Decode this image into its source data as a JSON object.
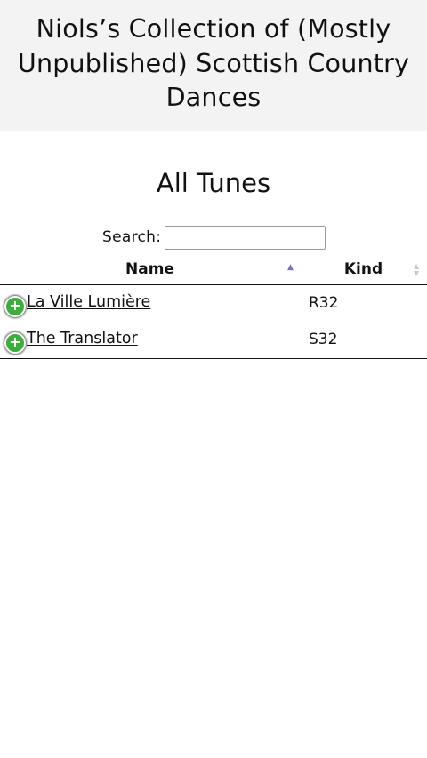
{
  "header": {
    "site_title": "Niols’s Collection of (Mostly Unpublished) Scottish Country Dances"
  },
  "page": {
    "title": "All Tunes"
  },
  "search": {
    "label": "Search:",
    "value": "",
    "placeholder": ""
  },
  "table": {
    "columns": [
      {
        "label": "Name",
        "sort": "ascending",
        "sort_icon": "sort-ascending-icon"
      },
      {
        "label": "Kind",
        "sort": "none",
        "sort_icon": "sort-both-icon"
      }
    ],
    "rows": [
      {
        "name": "La Ville Lumière",
        "kind": "R32",
        "expand_icon": "plus-circle-icon"
      },
      {
        "name": "The Translator",
        "kind": "S32",
        "expand_icon": "plus-circle-icon"
      }
    ]
  },
  "colors": {
    "header_bg": "#f3f3f3",
    "expand_button": "#3cae3c",
    "sort_active": "#6f72c8",
    "sort_inactive": "#c9c9c9"
  },
  "icons": {
    "expand_glyph": "+",
    "sort_asc_glyph": "▲",
    "sort_up_glyph": "▲",
    "sort_down_glyph": "▼"
  }
}
